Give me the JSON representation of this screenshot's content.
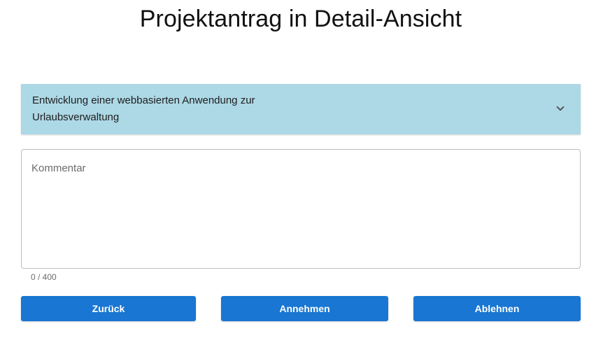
{
  "page": {
    "title": "Projektantrag in Detail-Ansicht"
  },
  "project": {
    "title": "Entwicklung einer webbasierten Anwendung zur Urlaubsverwaltung",
    "expand_icon": "chevron-down-icon"
  },
  "comment": {
    "placeholder": "Kommentar",
    "value": "",
    "counter": "0 / 400"
  },
  "actions": {
    "back_label": "Zurück",
    "accept_label": "Annehmen",
    "reject_label": "Ablehnen"
  },
  "colors": {
    "accordion_bg": "#add8e6",
    "button_bg": "#1976d2",
    "button_text": "#ffffff"
  }
}
